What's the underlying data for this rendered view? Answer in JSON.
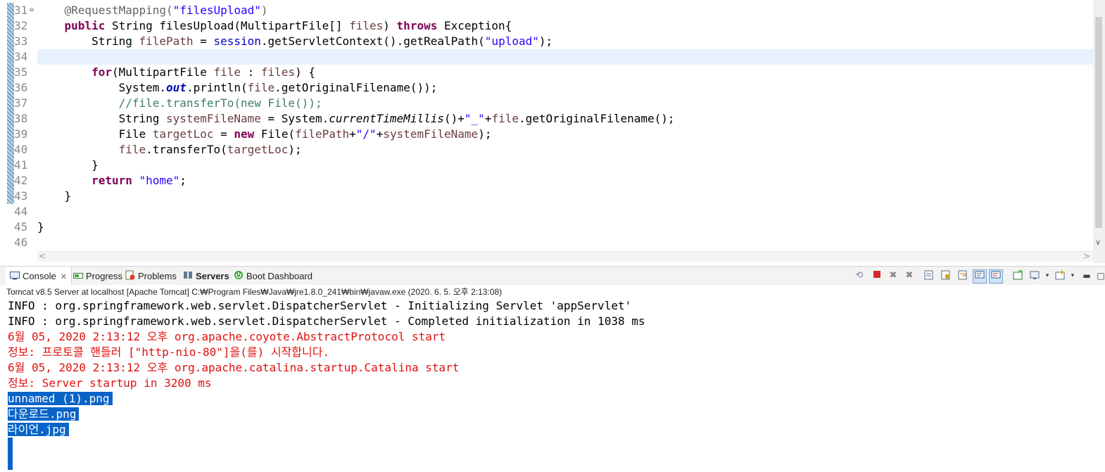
{
  "editor": {
    "lines": [
      {
        "num": "31",
        "fold": "⊖",
        "segments": [
          {
            "t": "    "
          },
          {
            "t": "@RequestMapping(",
            "c": "ann"
          },
          {
            "t": "\"filesUpload\"",
            "c": "str"
          },
          {
            "t": ")",
            "c": "ann"
          }
        ]
      },
      {
        "num": "32",
        "segments": [
          {
            "t": "    "
          },
          {
            "t": "public",
            "c": "kw"
          },
          {
            "t": " String filesUpload(MultipartFile[] "
          },
          {
            "t": "files",
            "c": "var"
          },
          {
            "t": ") "
          },
          {
            "t": "throws",
            "c": "kw"
          },
          {
            "t": " Exception{"
          }
        ]
      },
      {
        "num": "33",
        "segments": [
          {
            "t": "        String "
          },
          {
            "t": "filePath",
            "c": "var"
          },
          {
            "t": " = "
          },
          {
            "t": "session",
            "c": "fld2"
          },
          {
            "t": ".getServletContext().getRealPath("
          },
          {
            "t": "\"upload\"",
            "c": "str"
          },
          {
            "t": ");"
          }
        ]
      },
      {
        "num": "34",
        "current": true,
        "segments": [
          {
            "t": ""
          }
        ]
      },
      {
        "num": "35",
        "segments": [
          {
            "t": "        "
          },
          {
            "t": "for",
            "c": "kw"
          },
          {
            "t": "(MultipartFile "
          },
          {
            "t": "file",
            "c": "var"
          },
          {
            "t": " : "
          },
          {
            "t": "files",
            "c": "var"
          },
          {
            "t": ") {"
          }
        ]
      },
      {
        "num": "36",
        "segments": [
          {
            "t": "            System."
          },
          {
            "t": "out",
            "c": "fld"
          },
          {
            "t": ".println("
          },
          {
            "t": "file",
            "c": "var"
          },
          {
            "t": ".getOriginalFilename());"
          }
        ]
      },
      {
        "num": "37",
        "segments": [
          {
            "t": "            "
          },
          {
            "t": "//file.transferTo(new File());",
            "c": "cmt"
          }
        ]
      },
      {
        "num": "38",
        "segments": [
          {
            "t": "            String "
          },
          {
            "t": "systemFileName",
            "c": "var"
          },
          {
            "t": " = System."
          },
          {
            "t": "currentTimeMillis",
            "c": "itl"
          },
          {
            "t": "()+"
          },
          {
            "t": "\"_\"",
            "c": "str"
          },
          {
            "t": "+"
          },
          {
            "t": "file",
            "c": "var"
          },
          {
            "t": ".getOriginalFilename();"
          }
        ]
      },
      {
        "num": "39",
        "segments": [
          {
            "t": "            File "
          },
          {
            "t": "targetLoc",
            "c": "var"
          },
          {
            "t": " = "
          },
          {
            "t": "new",
            "c": "kw"
          },
          {
            "t": " File("
          },
          {
            "t": "filePath",
            "c": "var"
          },
          {
            "t": "+"
          },
          {
            "t": "\"/\"",
            "c": "str"
          },
          {
            "t": "+"
          },
          {
            "t": "systemFileName",
            "c": "var"
          },
          {
            "t": ");"
          }
        ]
      },
      {
        "num": "40",
        "segments": [
          {
            "t": "            "
          },
          {
            "t": "file",
            "c": "var"
          },
          {
            "t": ".transferTo("
          },
          {
            "t": "targetLoc",
            "c": "var"
          },
          {
            "t": ");"
          }
        ]
      },
      {
        "num": "41",
        "segments": [
          {
            "t": "        }"
          }
        ]
      },
      {
        "num": "42",
        "segments": [
          {
            "t": "        "
          },
          {
            "t": "return",
            "c": "kw"
          },
          {
            "t": " "
          },
          {
            "t": "\"home\"",
            "c": "str"
          },
          {
            "t": ";"
          }
        ]
      },
      {
        "num": "43",
        "segments": [
          {
            "t": "    }"
          }
        ]
      },
      {
        "num": "44",
        "segments": [
          {
            "t": ""
          }
        ]
      },
      {
        "num": "45",
        "segments": [
          {
            "t": "}"
          }
        ]
      },
      {
        "num": "46",
        "segments": [
          {
            "t": ""
          }
        ]
      }
    ]
  },
  "tabs": [
    {
      "label": "Console",
      "icon": "console-icon",
      "active": true
    },
    {
      "label": "Progress",
      "icon": "progress-icon"
    },
    {
      "label": "Problems",
      "icon": "problems-icon"
    },
    {
      "label": "Servers",
      "icon": "servers-icon",
      "bold": true
    },
    {
      "label": "Boot Dashboard",
      "icon": "boot-dashboard-icon"
    }
  ],
  "toolbar_icons": [
    "pin-icon",
    "terminate-icon",
    "remove-launch-icon",
    "remove-all-icon",
    "clear-console-icon",
    "scroll-lock-icon",
    "word-wrap-icon",
    "show-stdout-icon",
    "show-stderr-icon",
    "pin-console-icon",
    "display-console-icon",
    "dropdown-icon",
    "open-console-icon",
    "dropdown-icon",
    "minimize-icon",
    "maximize-icon"
  ],
  "colors": {
    "selection": "#0a64c8",
    "error_text": "#e01010",
    "keyword": "#7f0055",
    "string": "#2a00ff"
  },
  "process_label": "Tomcat v8.5 Server at localhost [Apache Tomcat] C:₩Program Files₩Java₩jre1.8.0_241₩bin₩javaw.exe (2020. 6. 5. 오후 2:13:08)",
  "console_lines": [
    {
      "text": "INFO : org.springframework.web.servlet.DispatcherServlet - Initializing Servlet 'appServlet'",
      "style": "black"
    },
    {
      "text": "INFO : org.springframework.web.servlet.DispatcherServlet - Completed initialization in 1038 ms",
      "style": "black"
    },
    {
      "text": "6월 05, 2020 2:13:12 오후 org.apache.coyote.AbstractProtocol start",
      "style": "red"
    },
    {
      "text": "정보: 프로토콜 핸들러 [\"http-nio-80\"]을(를) 시작합니다.",
      "style": "red"
    },
    {
      "text": "6월 05, 2020 2:13:12 오후 org.apache.catalina.startup.Catalina start",
      "style": "red"
    },
    {
      "text": "정보: Server startup in 3200 ms",
      "style": "red"
    },
    {
      "text": "unnamed (1).png",
      "style": "sel"
    },
    {
      "text": "다운로드.png",
      "style": "sel"
    },
    {
      "text": "라이언.jpg",
      "style": "sel"
    }
  ]
}
